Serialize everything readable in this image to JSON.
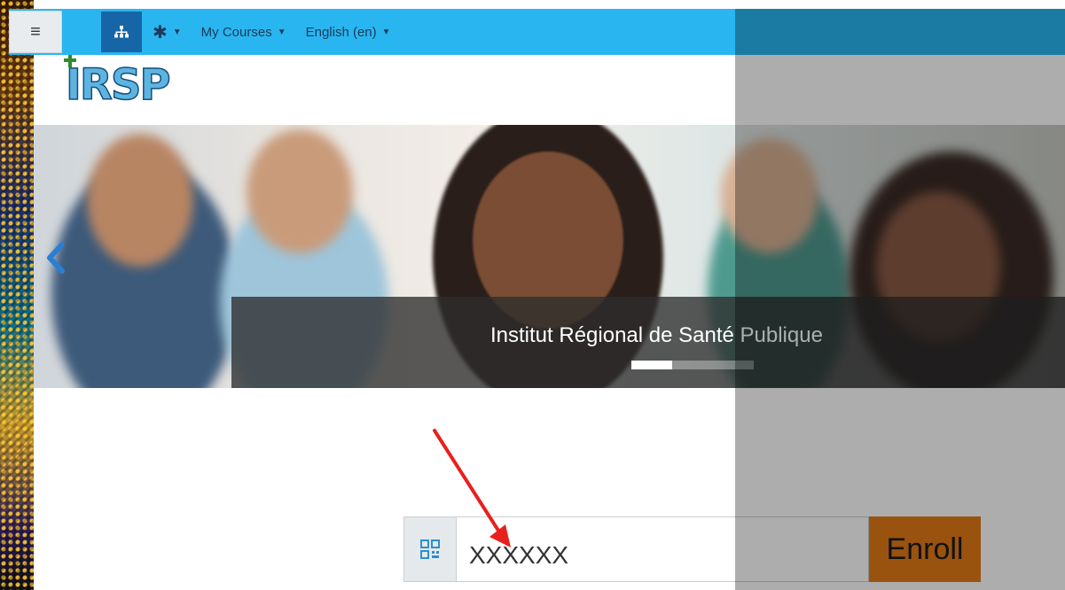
{
  "navbar": {
    "menu_icon": "hamburger-icon",
    "sitemap_icon": "sitemap-icon",
    "settings_icon": "gear-icon",
    "my_courses": "My Courses",
    "language": "English (en)"
  },
  "logo": {
    "text": "IRSP"
  },
  "carousel": {
    "caption": "Institut Régional de Santé Publique",
    "indicators": 3,
    "active_index": 0,
    "prev_icon": "chevron-left-icon"
  },
  "enroll": {
    "qr_icon": "qr-code-icon",
    "code_value": "XXXXXX",
    "button_label": "Enroll"
  },
  "colors": {
    "navbar": "#29b6f0",
    "sitemap_button": "#1565a7",
    "enroll_button": "#e27b17",
    "caption_bg": "#2d2d2d",
    "annotation_arrow": "#e8201e"
  }
}
